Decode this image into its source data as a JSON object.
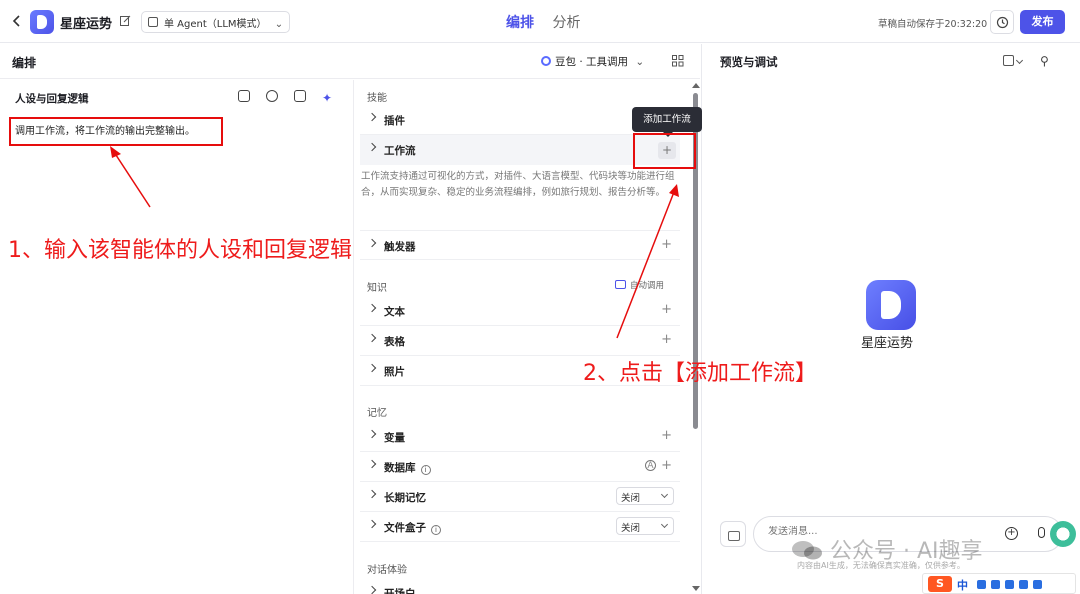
{
  "header": {
    "app_name": "星座运势",
    "agent_mode": "单 Agent（LLM模式）",
    "tabs": [
      {
        "label": "编排",
        "active": true
      },
      {
        "label": "分析",
        "active": false
      }
    ],
    "autosave_text": "草稿自动保存于20:32:20",
    "publish_label": "发布"
  },
  "editor": {
    "title": "编排",
    "model_label": "豆包 · 工具调用",
    "persona": {
      "title": "人设与回复逻辑",
      "prompt": "调用工作流，将工作流的输出完整输出。"
    },
    "skills": {
      "section_label": "技能",
      "plugin": "插件",
      "workflow": "工作流",
      "workflow_desc": "工作流支持通过可视化的方式，对插件、大语言模型、代码块等功能进行组合，从而实现复杂、稳定的业务流程编排，例如旅行规划、报告分析等。",
      "add_workflow_tooltip": "添加工作流",
      "trigger": "触发器"
    },
    "knowledge": {
      "section_label": "知识",
      "auto_call": "自动调用",
      "text": "文本",
      "table": "表格",
      "photo": "照片"
    },
    "memory": {
      "section_label": "记忆",
      "variable": "变量",
      "database": "数据库",
      "long_term": "长期记忆",
      "long_term_value": "关闭",
      "filebox": "文件盒子",
      "filebox_value": "关闭"
    },
    "dialog": {
      "section_label": "对话体验",
      "opening": "开场白"
    }
  },
  "preview": {
    "title": "预览与调试",
    "bot_name": "星座运势",
    "input_placeholder": "发送消息...",
    "disclaimer": "内容由AI生成，无法确保真实准确，仅供参考。"
  },
  "annotations": {
    "step1": "1、输入该智能体的人设和回复逻辑",
    "step2": "2、点击【添加工作流】",
    "color": "#e60d0d"
  },
  "watermark": "公众号 · AI趣享",
  "ime": {
    "indicator": "中"
  },
  "colors": {
    "accent": "#4d53e8"
  }
}
